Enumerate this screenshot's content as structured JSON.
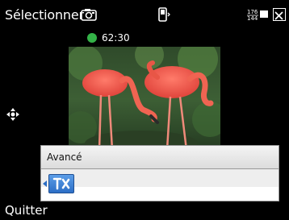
{
  "topbar": {
    "title": "Sélectionner",
    "title_icon": "camera-mode-icon",
    "phone_icon": "phone-signal-icon",
    "resolution_icon": "resolution-icon",
    "resolution_label": "176x144",
    "close_icon": "close-icon"
  },
  "recording": {
    "status_color": "#34b348",
    "timer": "62:30"
  },
  "preview": {
    "subject": "flamingo-preview"
  },
  "menu": {
    "header_label": "Avancé",
    "tool_icon": "tools-icon",
    "accent": "#2d6fc6"
  },
  "softkeys": {
    "left_label": "Quitter"
  }
}
